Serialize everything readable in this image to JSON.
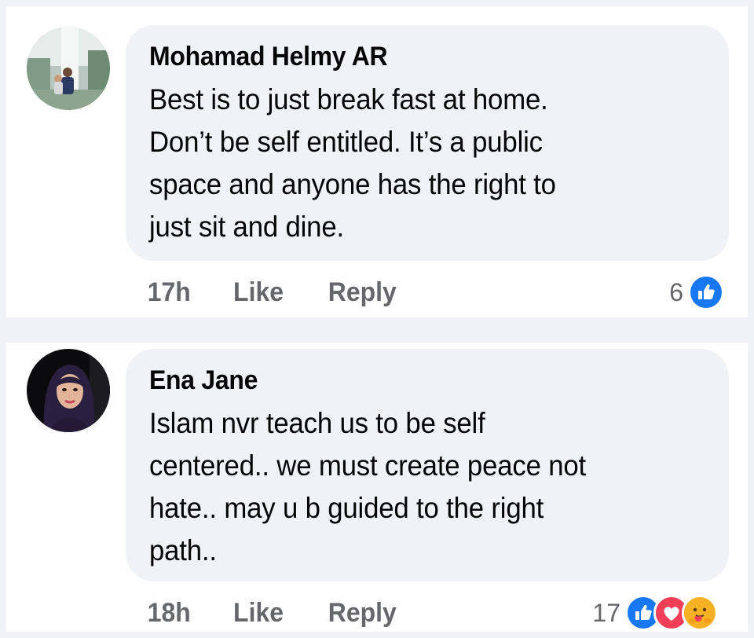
{
  "comments": [
    {
      "author": "Mohamad Helmy AR",
      "text_lines": [
        "Best is to just break fast at home.",
        "Don’t be self entitled. It’s a public",
        "space and anyone has the right to",
        "just sit and dine."
      ],
      "time": "17h",
      "like_label": "Like",
      "reply_label": "Reply",
      "reaction_count": "6",
      "reactions": [
        "like-icon"
      ]
    },
    {
      "author": "Ena Jane",
      "text_lines": [
        "Islam nvr teach us to be self",
        "centered.. we must create peace not",
        "hate.. may u b guided to the right",
        "path.."
      ],
      "time": "18h",
      "like_label": "Like",
      "reply_label": "Reply",
      "reaction_count": "17",
      "reactions": [
        "like-icon",
        "love-icon",
        "care-icon"
      ]
    }
  ],
  "colors": {
    "page_background": "#f0f2f5",
    "bubble_background": "#f0f2f5",
    "secondary_text": "#65676b",
    "like_blue": "#1877f2",
    "love_red": "#f33e58",
    "care_yellow": "#f7b125"
  }
}
